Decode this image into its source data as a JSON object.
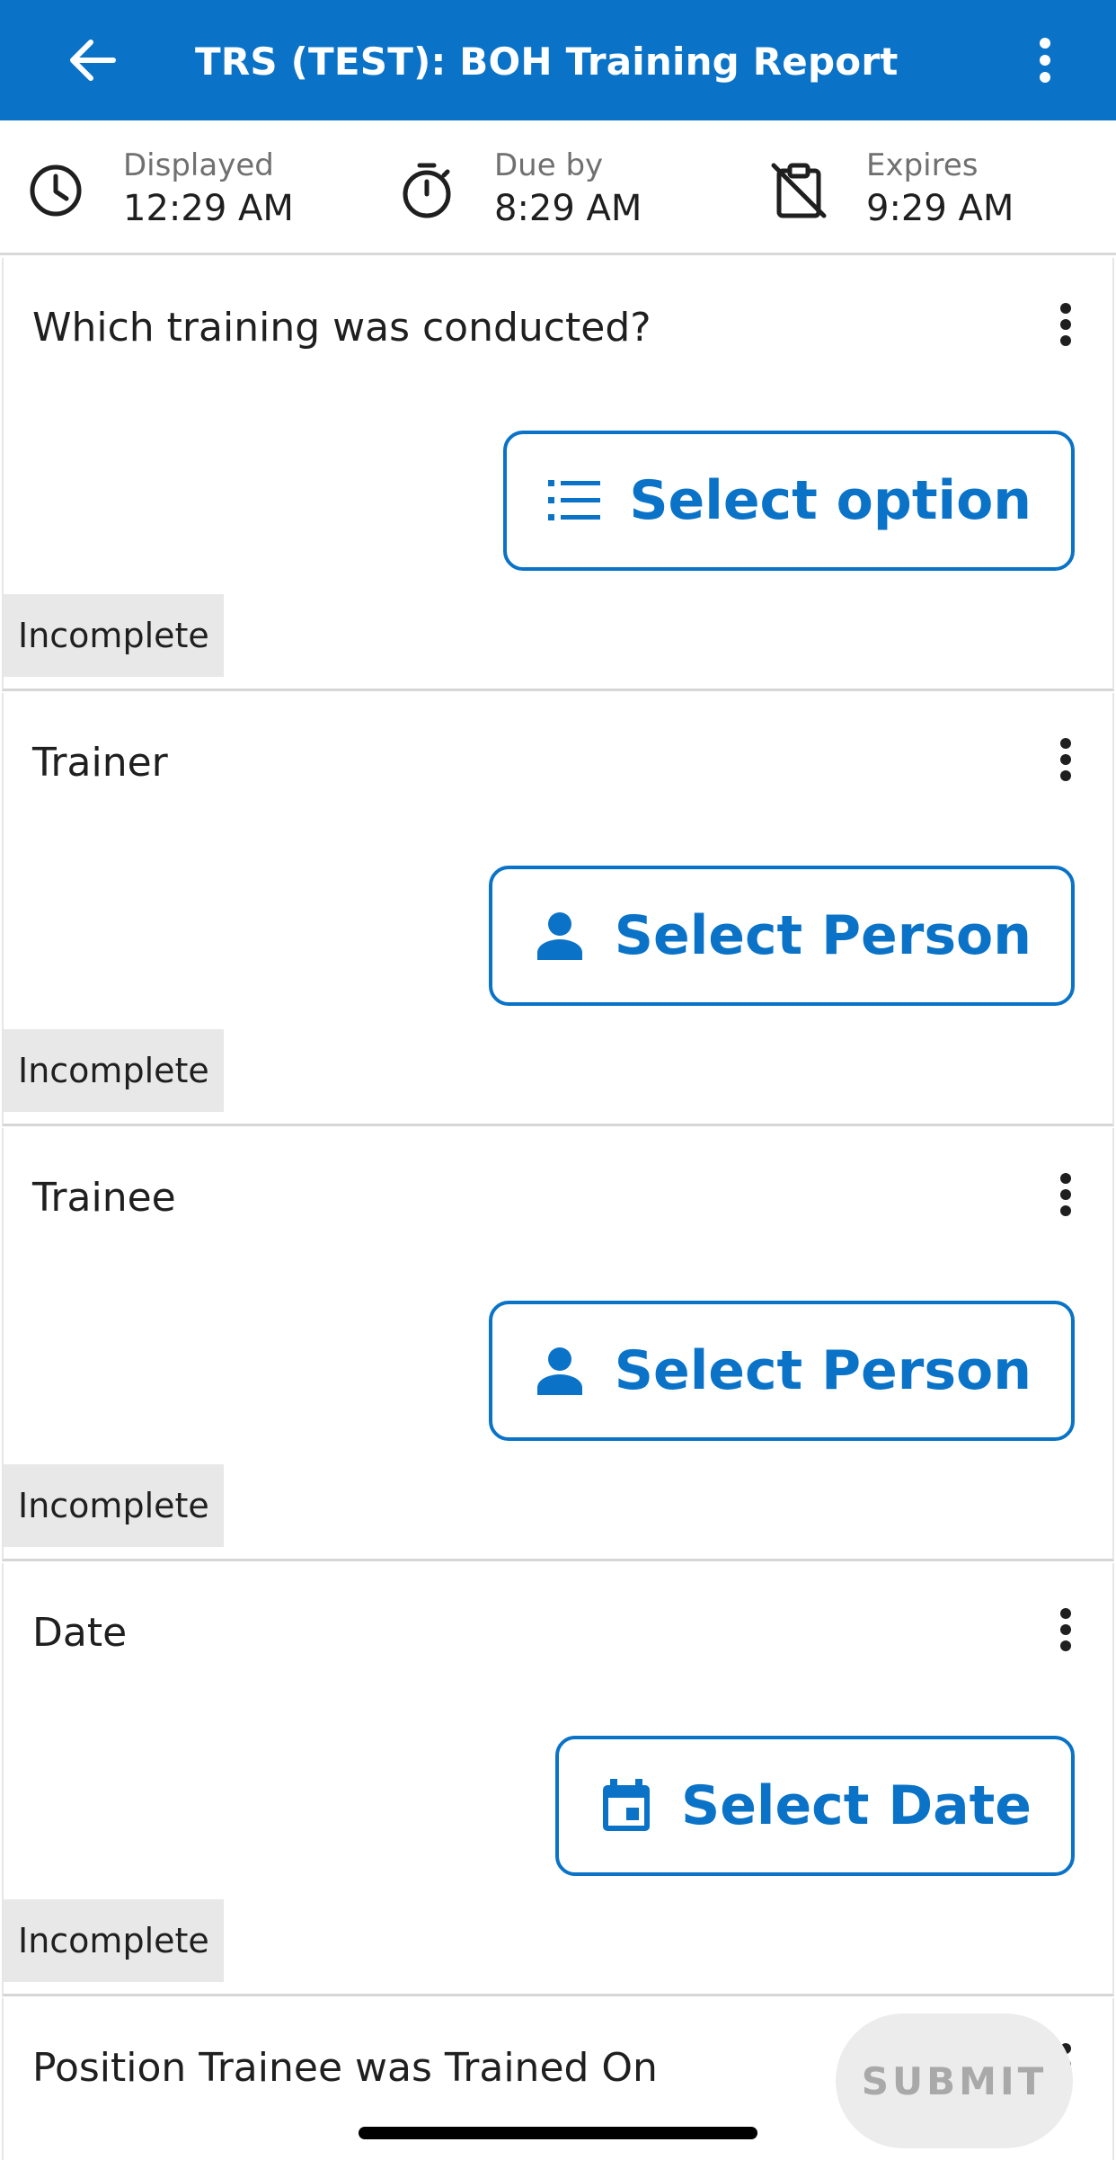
{
  "colors": {
    "brand": "#0a73c7",
    "status_bg": "#e8e8e8",
    "submit_text_disabled": "#a9a9a9"
  },
  "header": {
    "title": "TRS (TEST): BOH Training Report",
    "back_icon": "arrow-left-icon",
    "menu_icon": "more-vertical-icon"
  },
  "info": {
    "displayed": {
      "label": "Displayed",
      "value": "12:29 AM",
      "icon": "clock-icon"
    },
    "due": {
      "label": "Due by",
      "value": "8:29 AM",
      "icon": "stopwatch-icon"
    },
    "expires": {
      "label": "Expires",
      "value": "9:29 AM",
      "icon": "clipboard-off-icon"
    }
  },
  "questions": [
    {
      "text": "Which training was conducted?",
      "action_label": "Select option",
      "action_icon": "list-icon",
      "status": "Incomplete"
    },
    {
      "text": "Trainer",
      "action_label": "Select Person",
      "action_icon": "person-icon",
      "status": "Incomplete"
    },
    {
      "text": "Trainee",
      "action_label": "Select Person",
      "action_icon": "person-icon",
      "status": "Incomplete"
    },
    {
      "text": "Date",
      "action_label": "Select Date",
      "action_icon": "calendar-icon",
      "status": "Incomplete"
    },
    {
      "text": "Position Trainee was Trained On"
    }
  ],
  "submit_label": "SUBMIT"
}
